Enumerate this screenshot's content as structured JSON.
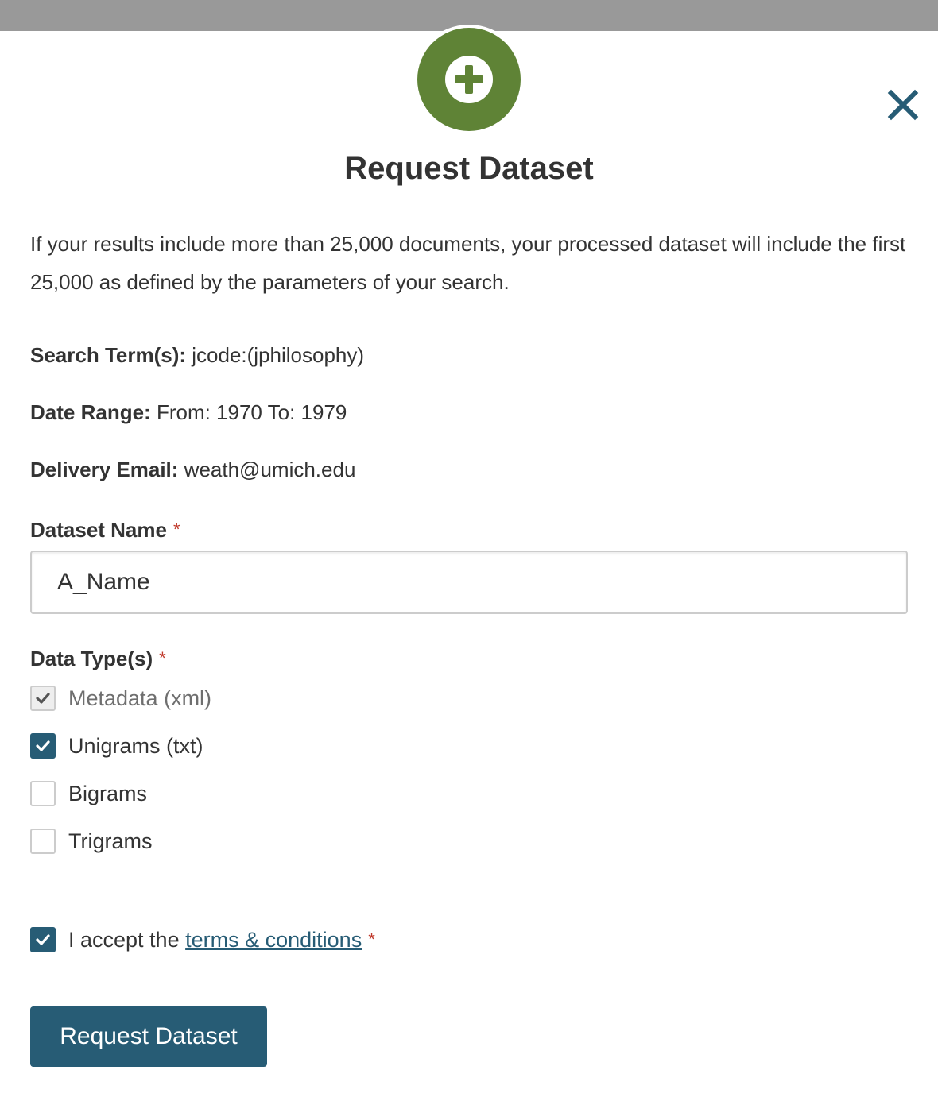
{
  "modal": {
    "title": "Request Dataset",
    "intro": "If your results include more than 25,000 documents, your processed dataset will include the first 25,000 as defined by the parameters of your search.",
    "icons": {
      "header": "plus-circle-icon",
      "close": "close-icon",
      "check": "checkmark-icon"
    },
    "colors": {
      "badge": "#5f8336",
      "accent": "#275c75",
      "required": "#c0392b"
    }
  },
  "summary": {
    "search_terms_label": "Search Term(s):",
    "search_terms_value": "jcode:(jphilosophy)",
    "date_range_label": "Date Range:",
    "date_range_value": "From: 1970 To: 1979",
    "email_label": "Delivery Email:",
    "email_value": "weath@umich.edu"
  },
  "form": {
    "dataset_name_label": "Dataset Name",
    "dataset_name_value": "A_Name",
    "required_marker": "*",
    "data_types_label": "Data Type(s)",
    "data_types": [
      {
        "label": "Metadata (xml)",
        "checked": true,
        "disabled": true
      },
      {
        "label": "Unigrams (txt)",
        "checked": true,
        "disabled": false
      },
      {
        "label": "Bigrams",
        "checked": false,
        "disabled": false
      },
      {
        "label": "Trigrams",
        "checked": false,
        "disabled": false
      }
    ],
    "terms_prefix": "I accept the",
    "terms_link": "terms & conditions",
    "terms_checked": true,
    "submit_label": "Request Dataset"
  }
}
